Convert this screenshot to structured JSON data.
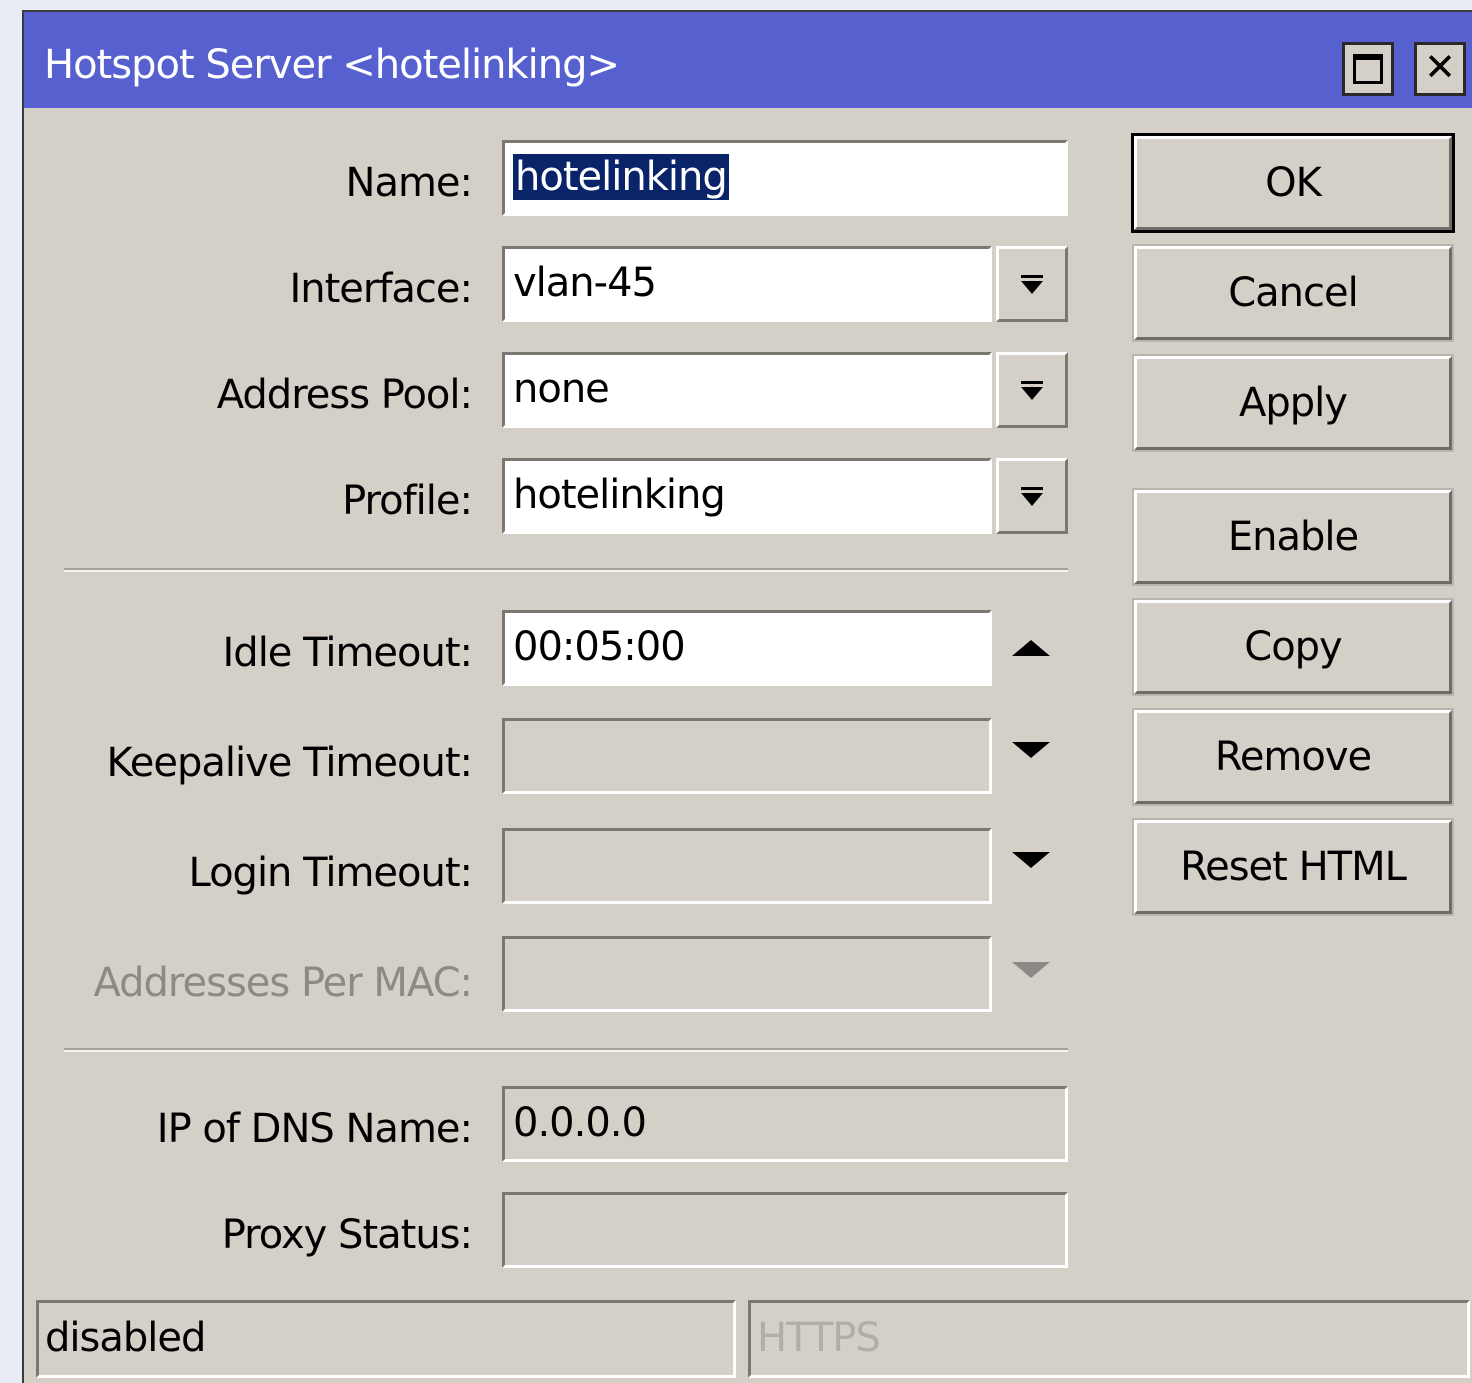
{
  "window": {
    "title": "Hotspot Server <hotelinking>",
    "maximize_icon": "maximize-icon",
    "close_icon": "close-icon"
  },
  "form": {
    "name": {
      "label": "Name:",
      "value": "hotelinking"
    },
    "interface": {
      "label": "Interface:",
      "value": "vlan-45"
    },
    "address_pool": {
      "label": "Address Pool:",
      "value": "none"
    },
    "profile": {
      "label": "Profile:",
      "value": "hotelinking"
    },
    "idle_timeout": {
      "label": "Idle Timeout:",
      "value": "00:05:00"
    },
    "keepalive_timeout": {
      "label": "Keepalive Timeout:",
      "value": ""
    },
    "login_timeout": {
      "label": "Login Timeout:",
      "value": ""
    },
    "addresses_per_mac": {
      "label": "Addresses Per MAC:",
      "value": ""
    },
    "ip_of_dns_name": {
      "label": "IP of DNS Name:",
      "value": "0.0.0.0"
    },
    "proxy_status": {
      "label": "Proxy Status:",
      "value": ""
    }
  },
  "buttons": {
    "ok": "OK",
    "cancel": "Cancel",
    "apply": "Apply",
    "enable": "Enable",
    "copy": "Copy",
    "remove": "Remove",
    "reset_html": "Reset HTML"
  },
  "statusbar": {
    "left": "disabled",
    "right": "HTTPS"
  },
  "colors": {
    "titlebar": "#5660cf",
    "dialog_bg": "#d4d0c8",
    "selection": "#0a246a"
  }
}
